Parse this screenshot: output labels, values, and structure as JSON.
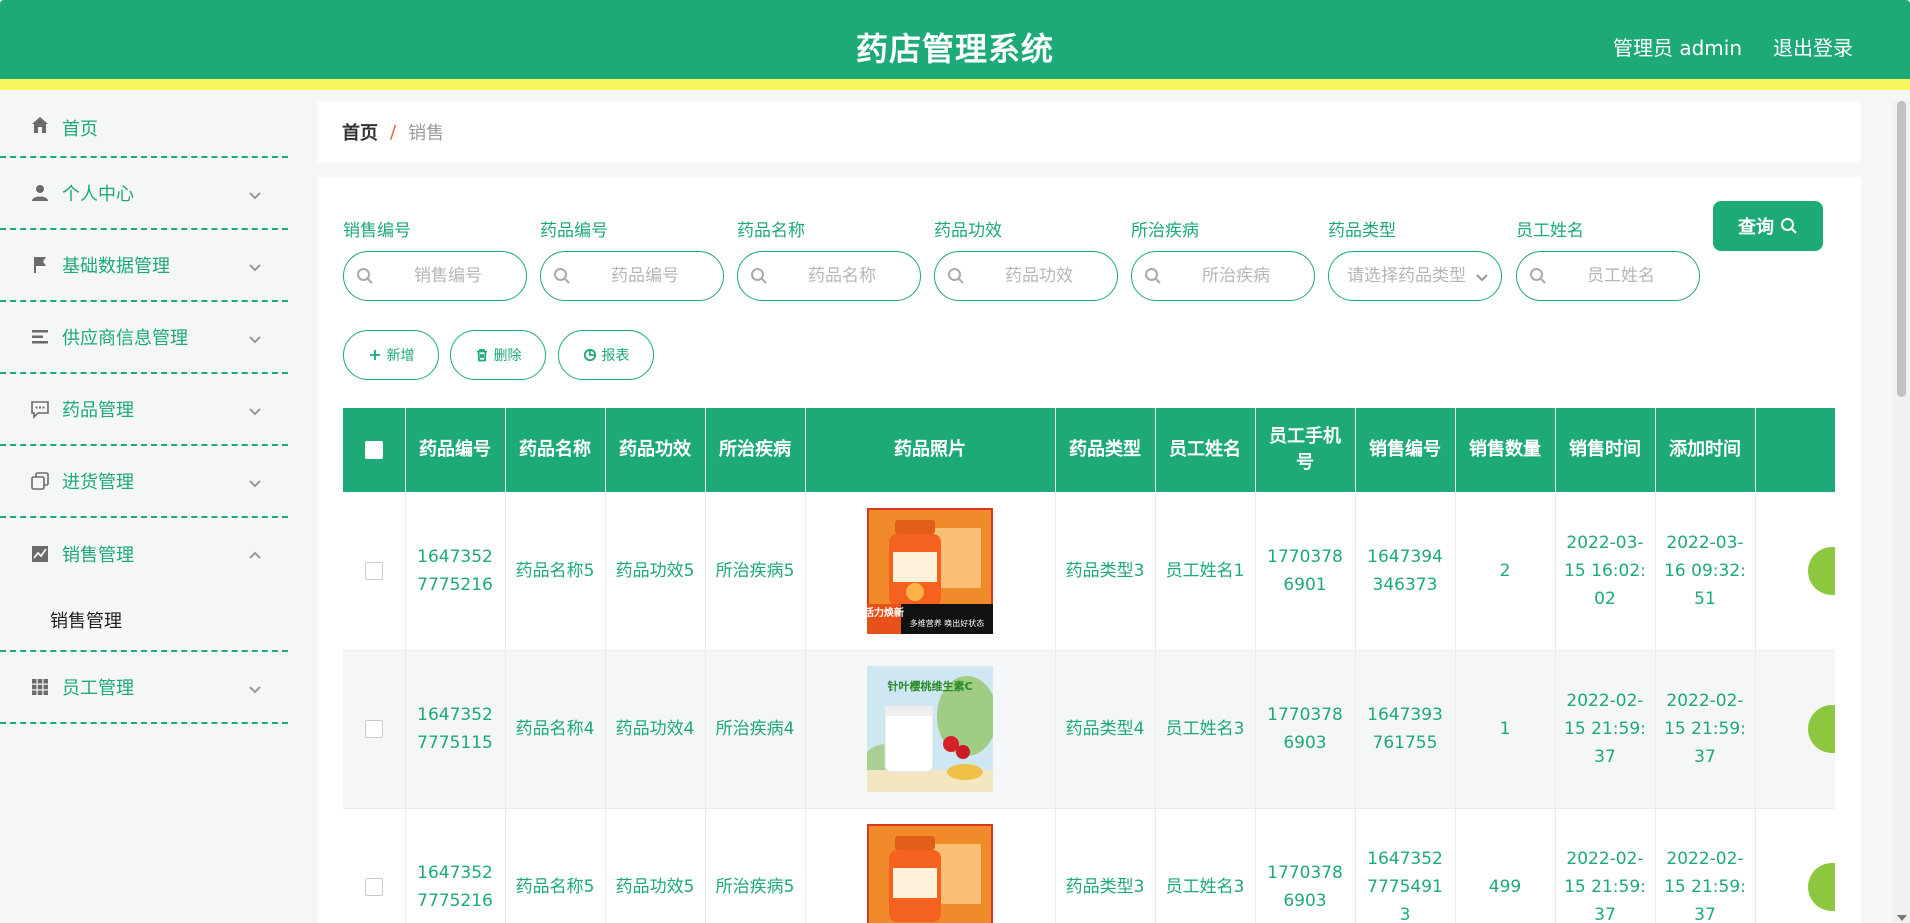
{
  "header": {
    "title": "药店管理系统",
    "user": "管理员 admin",
    "logout": "退出登录"
  },
  "sidebar": {
    "items": [
      {
        "label": "首页",
        "icon": "home-icon"
      },
      {
        "label": "个人中心",
        "icon": "user-icon"
      },
      {
        "label": "基础数据管理",
        "icon": "flag-icon"
      },
      {
        "label": "供应商信息管理",
        "icon": "list-icon"
      },
      {
        "label": "药品管理",
        "icon": "chat-icon"
      },
      {
        "label": "进货管理",
        "icon": "copy-icon"
      },
      {
        "label": "销售管理",
        "icon": "chart-icon"
      },
      {
        "label": "员工管理",
        "icon": "grid-icon"
      }
    ],
    "sub_item": "销售管理"
  },
  "breadcrumb": {
    "home": "首页",
    "separator": "/",
    "current": "销售"
  },
  "search": {
    "fields": [
      {
        "label": "销售编号",
        "placeholder": "销售编号"
      },
      {
        "label": "药品编号",
        "placeholder": "药品编号"
      },
      {
        "label": "药品名称",
        "placeholder": "药品名称"
      },
      {
        "label": "药品功效",
        "placeholder": "药品功效"
      },
      {
        "label": "所治疾病",
        "placeholder": "所治疾病"
      },
      {
        "label": "药品类型",
        "placeholder": "请选择药品类型"
      },
      {
        "label": "员工姓名",
        "placeholder": "员工姓名"
      }
    ],
    "query_label": "查询"
  },
  "actions": {
    "add": "新增",
    "delete": "删除",
    "report": "报表"
  },
  "table": {
    "headers": [
      "药品编号",
      "药品名称",
      "药品功效",
      "所治疾病",
      "药品照片",
      "药品类型",
      "员工姓名",
      "员工手机号",
      "销售编号",
      "销售数量",
      "销售时间",
      "添加时间"
    ],
    "rows": [
      {
        "drug_no": "16473527775216",
        "name": "药品名称5",
        "effect": "药品功效5",
        "disease": "所治疾病5",
        "photo": "orange-bottle",
        "photo_text_a": "活力焕新",
        "photo_text_b": "多维营养 唤出好状态",
        "type": "药品类型3",
        "staff": "员工姓名1",
        "phone": "17703786901",
        "sale_no": "1647394346373",
        "qty": "2",
        "sale_time": "2022-03-15 16:02:02",
        "add_time": "2022-03-16 09:32:51"
      },
      {
        "drug_no": "16473527775115",
        "name": "药品名称4",
        "effect": "药品功效4",
        "disease": "所治疾病4",
        "photo": "white-jar",
        "photo_text_a": "针叶樱桃维生素C",
        "photo_text_b": "",
        "type": "药品类型4",
        "staff": "员工姓名3",
        "phone": "17703786903",
        "sale_no": "1647393761755",
        "qty": "1",
        "sale_time": "2022-02-15 21:59:37",
        "add_time": "2022-02-15 21:59:37"
      },
      {
        "drug_no": "16473527775216",
        "name": "药品名称5",
        "effect": "药品功效5",
        "disease": "所治疾病5",
        "photo": "orange-bottle",
        "photo_text_a": "",
        "photo_text_b": "",
        "type": "药品类型3",
        "staff": "员工姓名3",
        "phone": "17703786903",
        "sale_no": "16473527775491 3",
        "qty": "499",
        "sale_time": "2022-02-15 21:59:37",
        "add_time": "2022-02-15 21:59:37"
      }
    ]
  },
  "colors": {
    "primary": "#1daa76",
    "accent_strip": "#f6f95e",
    "row_action": "#8dc63f",
    "breadcrumb_separator": "#e8613b"
  }
}
